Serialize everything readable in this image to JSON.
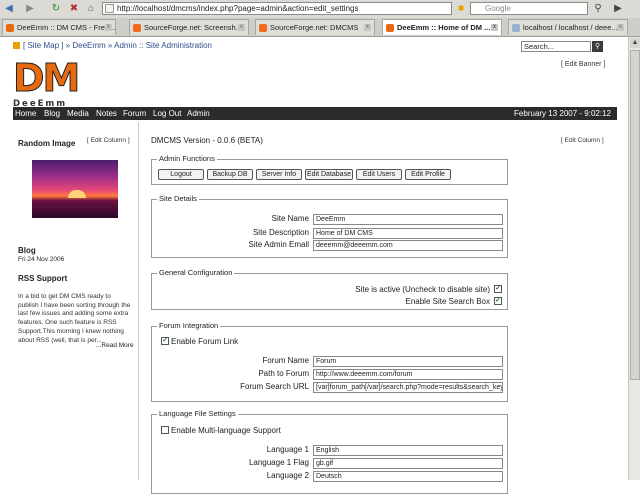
{
  "browser": {
    "url": "http://localhost/dmcms/index.php?page=admin&action=edit_settings",
    "search_placeholder": "Google",
    "tabs": [
      {
        "label": "DeeEmm :: DM CMS - Free ..."
      },
      {
        "label": "SourceForge.net: Screensh..."
      },
      {
        "label": "SourceForge.net: DMCMS"
      },
      {
        "label": "DeeEmm :: Home of DM ..."
      },
      {
        "label": "localhost / localhost / deee..."
      }
    ]
  },
  "site": {
    "breadcrumb": "[ Site Map ] » DeeEmm » Admin :: Site Administration",
    "search_value": "Search...",
    "edit_banner": "[ Edit Banner ]",
    "logo_big": "DM",
    "logo_small": "DeeEmm",
    "nav": [
      "Home",
      "Blog",
      "Media",
      "Notes",
      "Forum",
      "Log Out",
      "Admin"
    ],
    "date": "February 13 2007 - 9:02:12"
  },
  "left": {
    "random_image_title": "Random Image",
    "edit_column": "[ Edit Column ]",
    "blog_title": "Blog",
    "blog_date": "Fri 24 Nov 2006",
    "rss_title": "RSS Support",
    "rss_text": "In a bid to get DM CMS ready to publish I have been sorting through the last few issues and adding some extra features. One such feature is RSS Support.This morning I knew nothing about RSS (well, that is per...",
    "read_more": "...Read More"
  },
  "main": {
    "version": "DMCMS Version - 0.0.6 (BETA)",
    "edit_column": "[ Edit Column ]",
    "admin_functions": {
      "legend": "Admin Functions",
      "buttons": [
        "Logout",
        "Backup DB",
        "Server Info",
        "Edit Database",
        "Edit Users",
        "Edit Profile"
      ]
    },
    "site_details": {
      "legend": "Site Details",
      "site_name_label": "Site Name",
      "site_name": "DeeEmm",
      "site_desc_label": "Site Description",
      "site_desc": "Home of DM CMS",
      "admin_email_label": "Site Admin Email",
      "admin_email": "deeemm@deeemm.com"
    },
    "general": {
      "legend": "General Configuration",
      "active_label": "Site is active (Uncheck to disable site)",
      "search_label": "Enable Site Search Box"
    },
    "forum": {
      "legend": "Forum Integration",
      "enable_label": "Enable Forum Link",
      "name_label": "Forum Name",
      "name": "Forum",
      "path_label": "Path to Forum",
      "path": "http://www.deeemm.com/forum",
      "search_url_label": "Forum Search URL",
      "search_url": "[var]forum_path[/var]/search.php?mode=results&search_keywo"
    },
    "language": {
      "legend": "Language File Settings",
      "multi_label": "Enable Multi-language Support",
      "lang1_label": "Language 1",
      "lang1": "English",
      "lang1_flag_label": "Language 1 Flag",
      "lang1_flag": "gb.gif",
      "lang2_label": "Language 2",
      "lang2": "Deutsch"
    }
  },
  "colors": {
    "logo_orange": "#e86a10",
    "navbar_bg": "#2b2b2b",
    "link_blue": "#334c8c"
  }
}
